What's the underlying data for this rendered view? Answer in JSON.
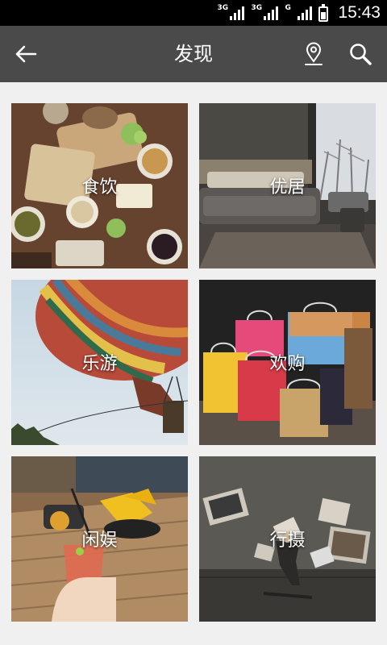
{
  "status_bar": {
    "networks": [
      {
        "label": "3G",
        "bars": 4
      },
      {
        "label": "3G",
        "bars": 4
      },
      {
        "label": "G",
        "bars": 4
      }
    ],
    "time": "15:43"
  },
  "app_bar": {
    "back_icon": "back-arrow-icon",
    "title": "发现",
    "location_icon": "location-pin-icon",
    "search_icon": "search-icon"
  },
  "categories": [
    {
      "label": "食饮",
      "photo": "food-spread"
    },
    {
      "label": "优居",
      "photo": "bedroom-interior"
    },
    {
      "label": "乐游",
      "photo": "hot-air-balloon"
    },
    {
      "label": "欢购",
      "photo": "shopping-bags"
    },
    {
      "label": "闲娱",
      "photo": "drink-and-snacks"
    },
    {
      "label": "行摄",
      "photo": "floating-photos"
    }
  ]
}
